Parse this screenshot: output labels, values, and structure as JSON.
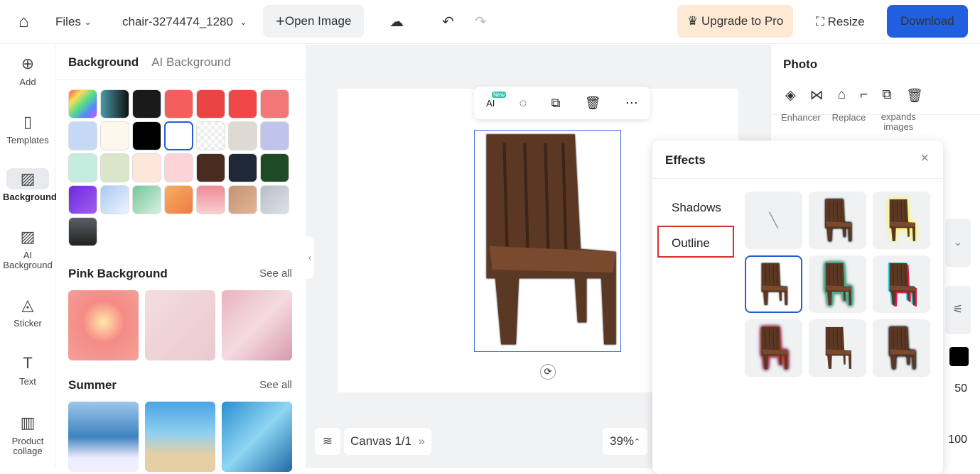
{
  "topbar": {
    "files": "Files",
    "filename": "chair-3274474_1280",
    "open_image": "Open Image",
    "upgrade": "Upgrade to Pro",
    "resize": "Resize",
    "download": "Download"
  },
  "rail": [
    {
      "label": "Add",
      "icon": "plus-circle-icon"
    },
    {
      "label": "Templates",
      "icon": "templates-icon"
    },
    {
      "label": "Background",
      "icon": "background-icon",
      "active": true
    },
    {
      "label": "AI Background",
      "icon": "ai-background-icon"
    },
    {
      "label": "Sticker",
      "icon": "sticker-icon"
    },
    {
      "label": "Text",
      "icon": "text-icon"
    },
    {
      "label": "Product collage",
      "icon": "collage-icon"
    }
  ],
  "panel": {
    "tabs": [
      "Background",
      "AI Background"
    ],
    "swatches": [
      "linear-gradient(135deg,#f55,#fd5,#5d8,#58f,#c5f)",
      "linear-gradient(90deg,#4a9aa8,#111)",
      "#1a1a1a",
      "#f25f5c",
      "#e94444",
      "#f04848",
      "#f27878",
      "#c3d9f5",
      "#fdf8ee",
      "#000000",
      "#ffffff",
      "checker",
      "#dcdad2",
      "#c0c3ec",
      "#c4ede0",
      "#d9e6c8",
      "#fde7da",
      "#fcd3d6",
      "#4a2c1e",
      "#1e2836",
      "#1e4a26",
      "linear-gradient(135deg,#6a2be0,#a45cf0)",
      "linear-gradient(135deg,#a9c9f4,#eef4fd)",
      "linear-gradient(135deg,#74c69a,#d8f0e0)",
      "linear-gradient(135deg,#f4b05a,#f27a4a)",
      "linear-gradient(180deg,#f08a96,#f9cfd0)",
      "linear-gradient(135deg,#c49372,#e2b496)",
      "linear-gradient(135deg,#b8bec9,#dde1e7)",
      "linear-gradient(180deg,#5a5e64,#222)"
    ],
    "sections": [
      {
        "title": "Pink Background",
        "see_all": "See all",
        "thumbs": [
          "radial-gradient(circle at 50% 45%,#ffe9a8 0,#f58b86 40%,#f4a19a 100%)",
          "linear-gradient(135deg,#f3dde0,#e9c9cf)",
          "linear-gradient(135deg,#e9b3c0,#f5dbe2,#d79aac)"
        ]
      },
      {
        "title": "Summer",
        "see_all": "See all",
        "thumbs": [
          "linear-gradient(180deg,#9cc7ea 0,#3f82c0 50%,#eef 80%)",
          "linear-gradient(180deg,#4aa3e6 0,#8fd0ef 45%,#e6cfa4 75%)",
          "linear-gradient(135deg,#2a8ed0,#8fd6f3,#1e6aa6)"
        ]
      }
    ]
  },
  "canvas": {
    "canvas_label": "Canvas 1/1",
    "zoom": "39%",
    "ai_badge": "New"
  },
  "right": {
    "title": "Photo",
    "cut_labels": [
      "Enhancer",
      "Replace",
      "expands images"
    ],
    "values": [
      "50",
      "100"
    ]
  },
  "effects": {
    "title": "Effects",
    "menu": [
      "Shadows",
      "Outline"
    ],
    "selected_menu": "Outline",
    "presets": [
      "none",
      "dark-outline",
      "yellow-glow",
      "white-outline",
      "teal-outline",
      "rgb-split",
      "red-outline",
      "thin-white",
      "black-outline"
    ],
    "selected_preset": 3
  }
}
